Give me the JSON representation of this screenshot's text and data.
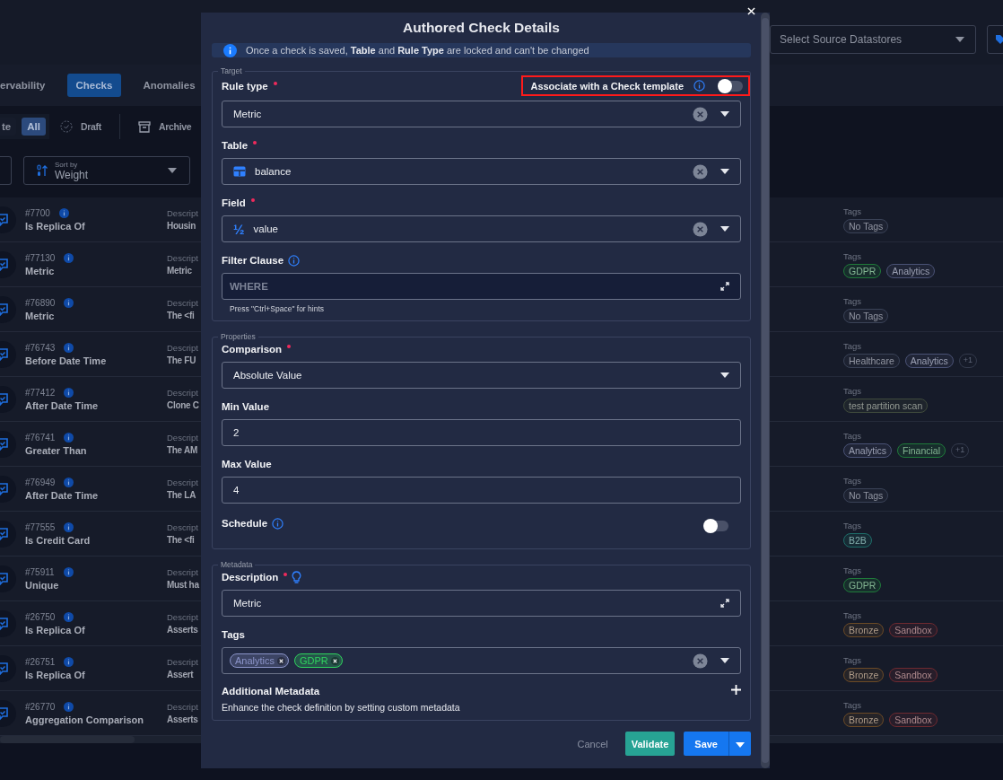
{
  "background": {
    "source_select": {
      "placeholder": "Select Source Datastores"
    },
    "tabs": [
      {
        "label": "ervability",
        "selected": false
      },
      {
        "label": "Checks",
        "selected": true
      },
      {
        "label": "Anomalies",
        "selected": false
      }
    ],
    "status_filters": [
      {
        "kind": "segment",
        "label": "te",
        "selected": false
      },
      {
        "kind": "segment",
        "label": "All",
        "selected": true
      },
      {
        "kind": "draft",
        "label": "Draft",
        "selected": false
      },
      {
        "kind": "archive",
        "label": "Archive",
        "selected": false
      }
    ],
    "sort": {
      "label": "Sort by",
      "value": "Weight"
    },
    "checks": [
      {
        "id": "#7700",
        "name": "Is Replica Of",
        "description_label": "Descript",
        "description": "Housin",
        "tags_label": "Tags",
        "tags": [
          {
            "label": "No Tags",
            "color": "#3a4257"
          }
        ]
      },
      {
        "id": "#77130",
        "name": "Metric",
        "description_label": "Descript",
        "description": "Metric",
        "tags_label": "Tags",
        "tags": [
          {
            "label": "GDPR",
            "color": "#1f7a3a"
          },
          {
            "label": "Analytics",
            "color": "#4a5275"
          }
        ]
      },
      {
        "id": "#76890",
        "name": "Metric",
        "description_label": "Descript",
        "description": "The <fi",
        "tags_label": "Tags",
        "tags": [
          {
            "label": "No Tags",
            "color": "#3a4257"
          }
        ]
      },
      {
        "id": "#76743",
        "name": "Before Date Time",
        "description_label": "Descript",
        "description": "The FU",
        "tags_label": "Tags",
        "tags": [
          {
            "label": "Healthcare",
            "color": "#3a4257"
          },
          {
            "label": "Analytics",
            "color": "#4a5275"
          }
        ],
        "more": "+1"
      },
      {
        "id": "#77412",
        "name": "After Date Time",
        "description_label": "Descript",
        "description": "Clone C",
        "tags_label": "Tags",
        "tags": [
          {
            "label": "test partition scan",
            "color": "#3f4a3c"
          }
        ]
      },
      {
        "id": "#76741",
        "name": "Greater Than",
        "description_label": "Descript",
        "description": "The AM",
        "tags_label": "Tags",
        "tags": [
          {
            "label": "Analytics",
            "color": "#4a5275"
          },
          {
            "label": "Financial",
            "color": "#1f7a3a"
          }
        ],
        "more": "+1"
      },
      {
        "id": "#76949",
        "name": "After Date Time",
        "description_label": "Descript",
        "description": "The LA",
        "tags_label": "Tags",
        "tags": [
          {
            "label": "No Tags",
            "color": "#3a4257"
          }
        ]
      },
      {
        "id": "#77555",
        "name": "Is Credit Card",
        "description_label": "Descript",
        "description": "The <fi",
        "tags_label": "Tags",
        "tags": [
          {
            "label": "B2B",
            "color": "#1e6e6a"
          }
        ]
      },
      {
        "id": "#75911",
        "name": "Unique",
        "description_label": "Descript",
        "description": "Must ha",
        "tags_label": "Tags",
        "tags": [
          {
            "label": "GDPR",
            "color": "#1f7a3a"
          }
        ]
      },
      {
        "id": "#26750",
        "name": "Is Replica Of",
        "description_label": "Descript",
        "description": "Asserts",
        "tags_label": "Tags",
        "tags": [
          {
            "label": "Bronze",
            "color": "#6b4a26"
          },
          {
            "label": "Sandbox",
            "color": "#6e2a30"
          }
        ]
      },
      {
        "id": "#26751",
        "name": "Is Replica Of",
        "description_label": "Descript",
        "description": "Assert",
        "tags_label": "Tags",
        "tags": [
          {
            "label": "Bronze",
            "color": "#6b4a26"
          },
          {
            "label": "Sandbox",
            "color": "#6e2a30"
          }
        ]
      },
      {
        "id": "#26770",
        "name": "Aggregation Comparison",
        "description_label": "Descript",
        "description": "Asserts",
        "tags_label": "Tags",
        "tags": [
          {
            "label": "Bronze",
            "color": "#6b4a26"
          },
          {
            "label": "Sandbox",
            "color": "#6e2a30"
          }
        ]
      }
    ]
  },
  "modal": {
    "title": "Authored Check Details",
    "notice": "Once a check is saved, **Table** and **Rule Type** are locked and can't be changed",
    "sections": [
      {
        "legend": "Target",
        "fields": [
          {
            "kind": "clearable-select",
            "label": "Rule type",
            "required": true,
            "value": "Metric",
            "template_toggle": {
              "label": "Associate with a Check template",
              "on": false,
              "highlighted": true
            }
          },
          {
            "kind": "table-select",
            "label": "Table",
            "required": true,
            "value": "balance"
          },
          {
            "kind": "clearable-select",
            "label": "Field",
            "required": true,
            "value": "value",
            "glyph": "½"
          },
          {
            "kind": "clause",
            "label": "Filter Clause",
            "required": false,
            "placeholder": "WHERE",
            "hint": "Press \"Ctrl+Space\" for hints"
          }
        ]
      },
      {
        "legend": "Properties",
        "fields": [
          {
            "kind": "select",
            "label": "Comparison",
            "required": true,
            "value": "Absolute Value"
          },
          {
            "kind": "input",
            "label": "Min Value",
            "required": false,
            "value": "2"
          },
          {
            "kind": "input",
            "label": "Max Value",
            "required": false,
            "value": "4"
          },
          {
            "kind": "toggle",
            "label": "Schedule",
            "required": false,
            "on": false
          }
        ]
      },
      {
        "legend": "Metadata",
        "fields": [
          {
            "kind": "text",
            "label": "Description",
            "required": true,
            "value": "Metric"
          },
          {
            "kind": "tags",
            "label": "Tags",
            "required": false,
            "tags": [
              {
                "label": "Analytics",
                "color": "#8b94c9"
              },
              {
                "label": "GDPR",
                "color": "#2fd25e"
              }
            ]
          },
          {
            "kind": "add",
            "label": "Additional Metadata",
            "text": "Enhance the check definition by setting custom metadata"
          }
        ]
      }
    ],
    "buttons": [
      {
        "kind": "cancel",
        "label": "Cancel"
      },
      {
        "kind": "validate",
        "label": "Validate"
      },
      {
        "kind": "save",
        "label": "Save"
      }
    ]
  }
}
